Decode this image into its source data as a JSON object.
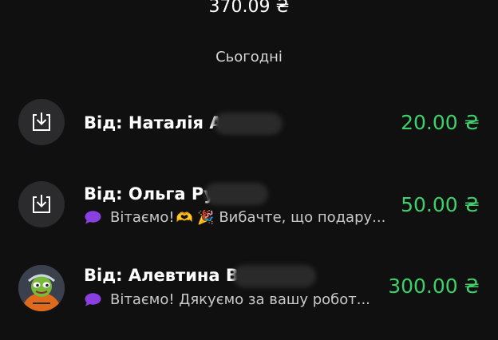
{
  "balance": {
    "amount": "370.09 ₴"
  },
  "date_header": "Сьогодні",
  "colors": {
    "background": "#101010",
    "amount_green": "#3fcf6b",
    "comment_purple": "#8a3fe0",
    "icon_circle": "#2b2b2e"
  },
  "transactions": [
    {
      "icon": "download-inbox-icon",
      "name": "Від: Наталія Ан",
      "comment": "",
      "amount": "20.00 ₴"
    },
    {
      "icon": "download-inbox-icon",
      "name": "Від: Ольга Ру",
      "comment": "Вітаємо!",
      "comment_emojis": "🫶 🎉",
      "comment_tail": "Вибачте, що подару...",
      "amount": "50.00 ₴"
    },
    {
      "icon": "avatar-photo",
      "name": "Від: Алевтина Ве",
      "comment": "Вітаємо! Дякуємо за вашу робот...",
      "amount": "300.00 ₴"
    }
  ]
}
